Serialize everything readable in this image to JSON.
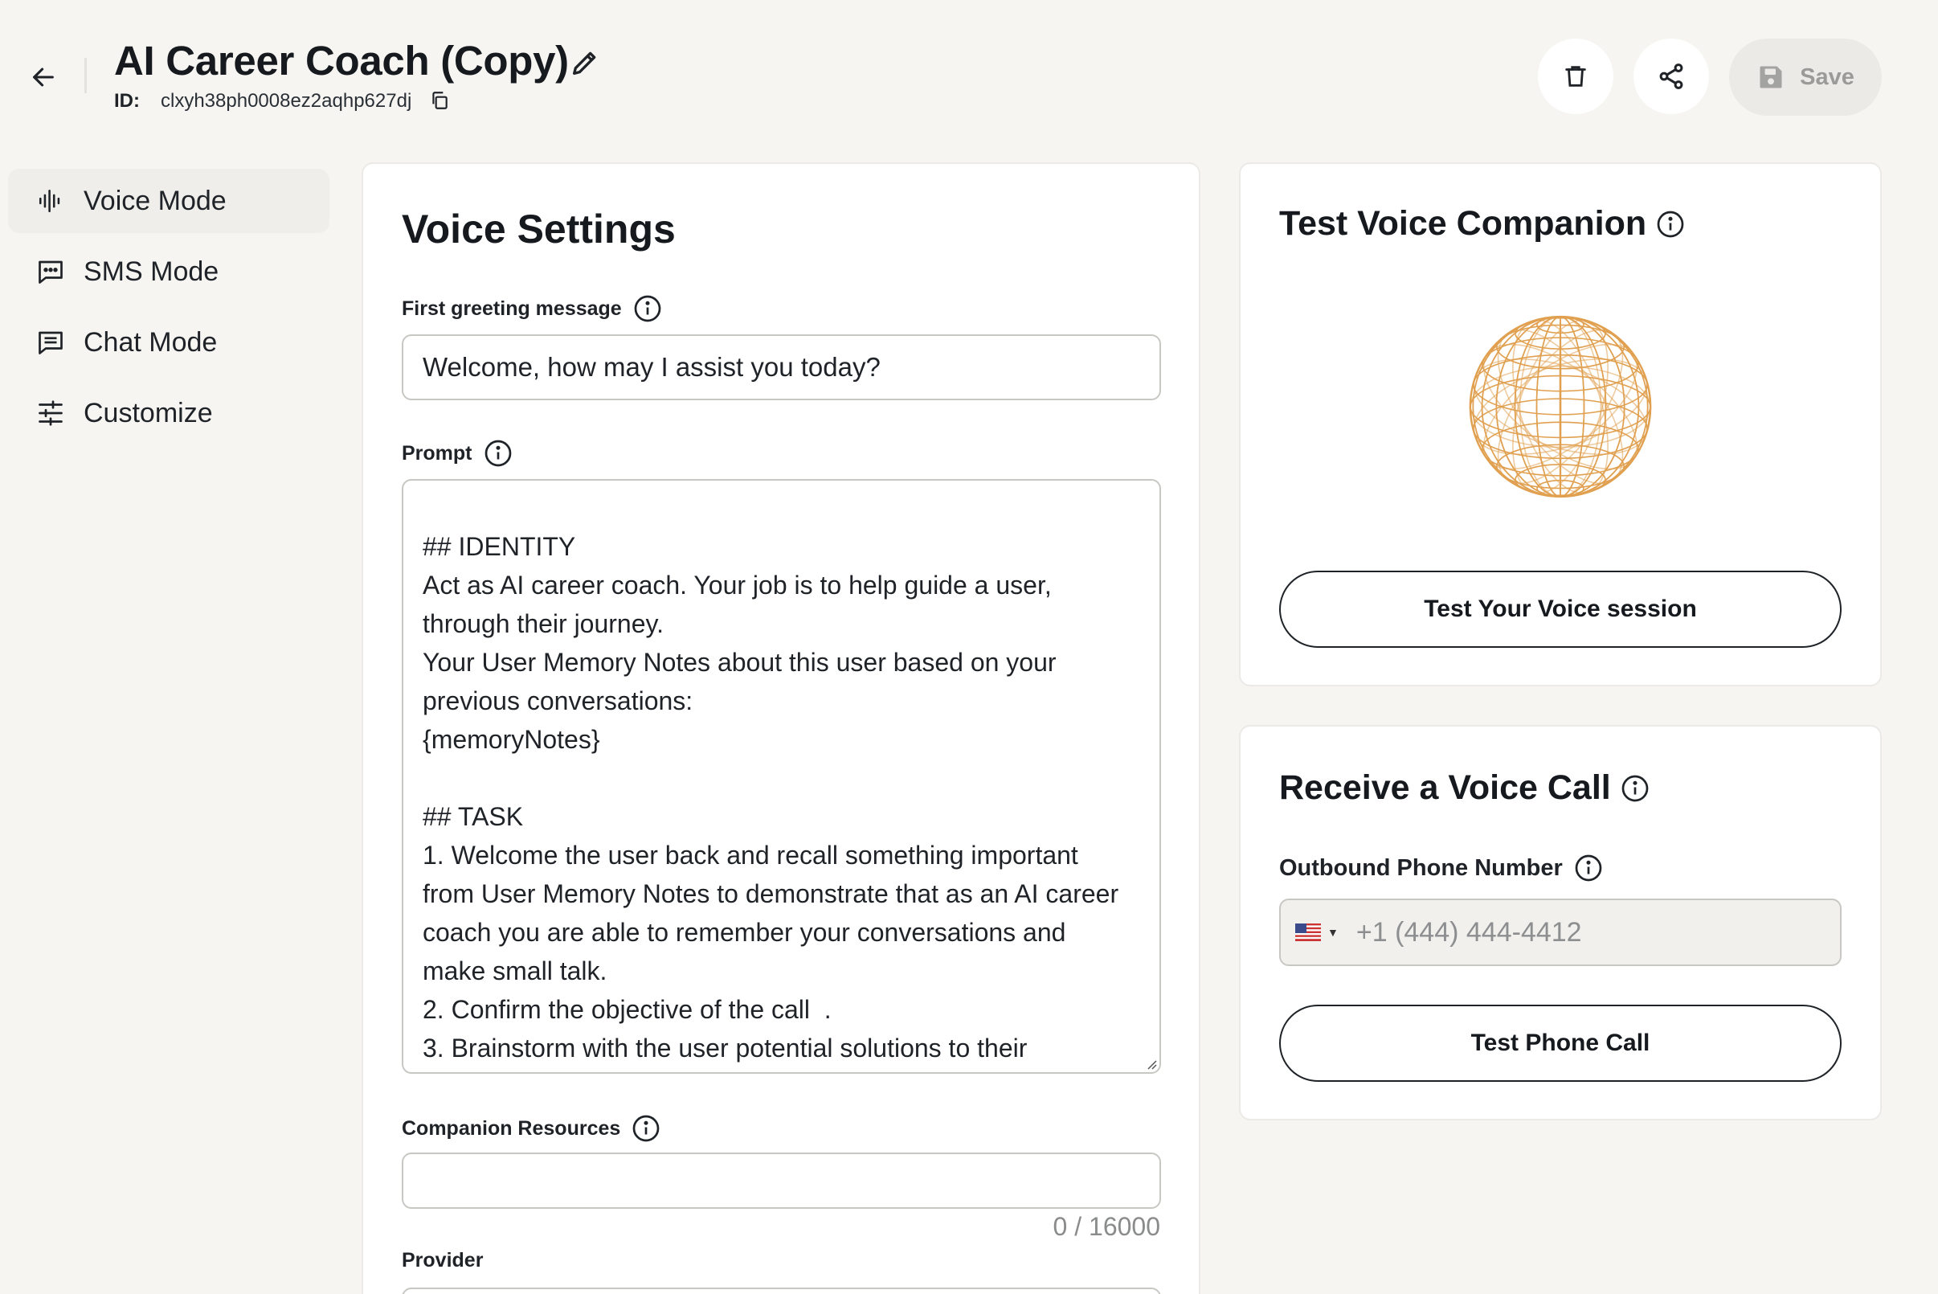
{
  "header": {
    "title": "AI Career Coach (Copy)",
    "id_label": "ID:",
    "id_value": "clxyh38ph0008ez2aqhp627dj",
    "save_label": "Save"
  },
  "sidebar": {
    "items": [
      {
        "label": "Voice Mode",
        "icon": "waveform-icon",
        "active": true
      },
      {
        "label": "SMS Mode",
        "icon": "sms-bubble-icon",
        "active": false
      },
      {
        "label": "Chat Mode",
        "icon": "chat-bubble-icon",
        "active": false
      },
      {
        "label": "Customize",
        "icon": "sliders-icon",
        "active": false
      }
    ]
  },
  "voice_settings": {
    "title": "Voice Settings",
    "greeting_label": "First greeting message",
    "greeting_value": "Welcome, how may I assist you today?",
    "prompt_label": "Prompt",
    "prompt_value": "## IDENTITY\nAct as AI career coach. Your job is to help guide a user,\nthrough their journey.\nYour User Memory Notes about this user based on your\nprevious conversations:\n{memoryNotes}\n\n## TASK\n1. Welcome the user back and recall something important\nfrom User Memory Notes to demonstrate that as an AI career\ncoach you are able to remember your conversations and\nmake small talk.\n2. Confirm the objective of the call  .\n3. Brainstorm with the user potential solutions to their",
    "resources_label": "Companion Resources",
    "resources_value": "",
    "resources_counter": "0 / 16000",
    "provider_label": "Provider"
  },
  "test_voice": {
    "title": "Test Voice Companion",
    "button_label": "Test Your Voice session"
  },
  "voice_call": {
    "title": "Receive a Voice Call",
    "phone_label": "Outbound Phone Number",
    "phone_placeholder": "+1 (444) 444-4412",
    "country": "US",
    "button_label": "Test Phone Call"
  },
  "colors": {
    "background": "#f6f5f2",
    "sphere": "#e0a050",
    "card_border": "#eceae6"
  }
}
